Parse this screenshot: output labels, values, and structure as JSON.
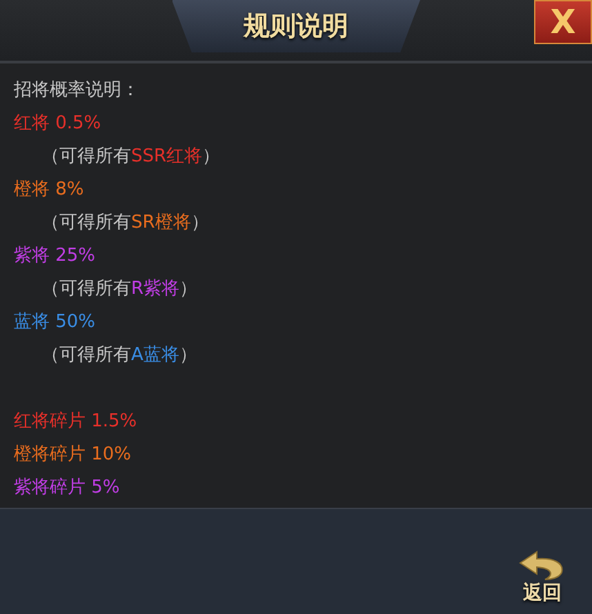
{
  "window": {
    "title": "规则说明",
    "close": "X"
  },
  "heading": "招将概率说明：",
  "rates": [
    {
      "text": "红将 0.5%",
      "color": "#e8302a",
      "note_prefix": "（可得所有",
      "note_highlight": "SSR红将",
      "note_suffix": "）"
    },
    {
      "text": "橙将 8%",
      "color": "#ea6d1e",
      "note_prefix": "（可得所有",
      "note_highlight": "SR橙将",
      "note_suffix": "）"
    },
    {
      "text": "紫将 25%",
      "color": "#c23ee6",
      "note_prefix": "（可得所有",
      "note_highlight": "R紫将",
      "note_suffix": "）"
    },
    {
      "text": "蓝将 50%",
      "color": "#3a8ee6",
      "note_prefix": "（可得所有",
      "note_highlight": "A蓝将",
      "note_suffix": "）"
    }
  ],
  "fragments": [
    {
      "text": "红将碎片 1.5%",
      "color": "#e8302a"
    },
    {
      "text": "橙将碎片 10%",
      "color": "#ea6d1e"
    },
    {
      "text": "紫将碎片 5%",
      "color": "#c23ee6"
    }
  ],
  "footer": {
    "back": "返回"
  }
}
